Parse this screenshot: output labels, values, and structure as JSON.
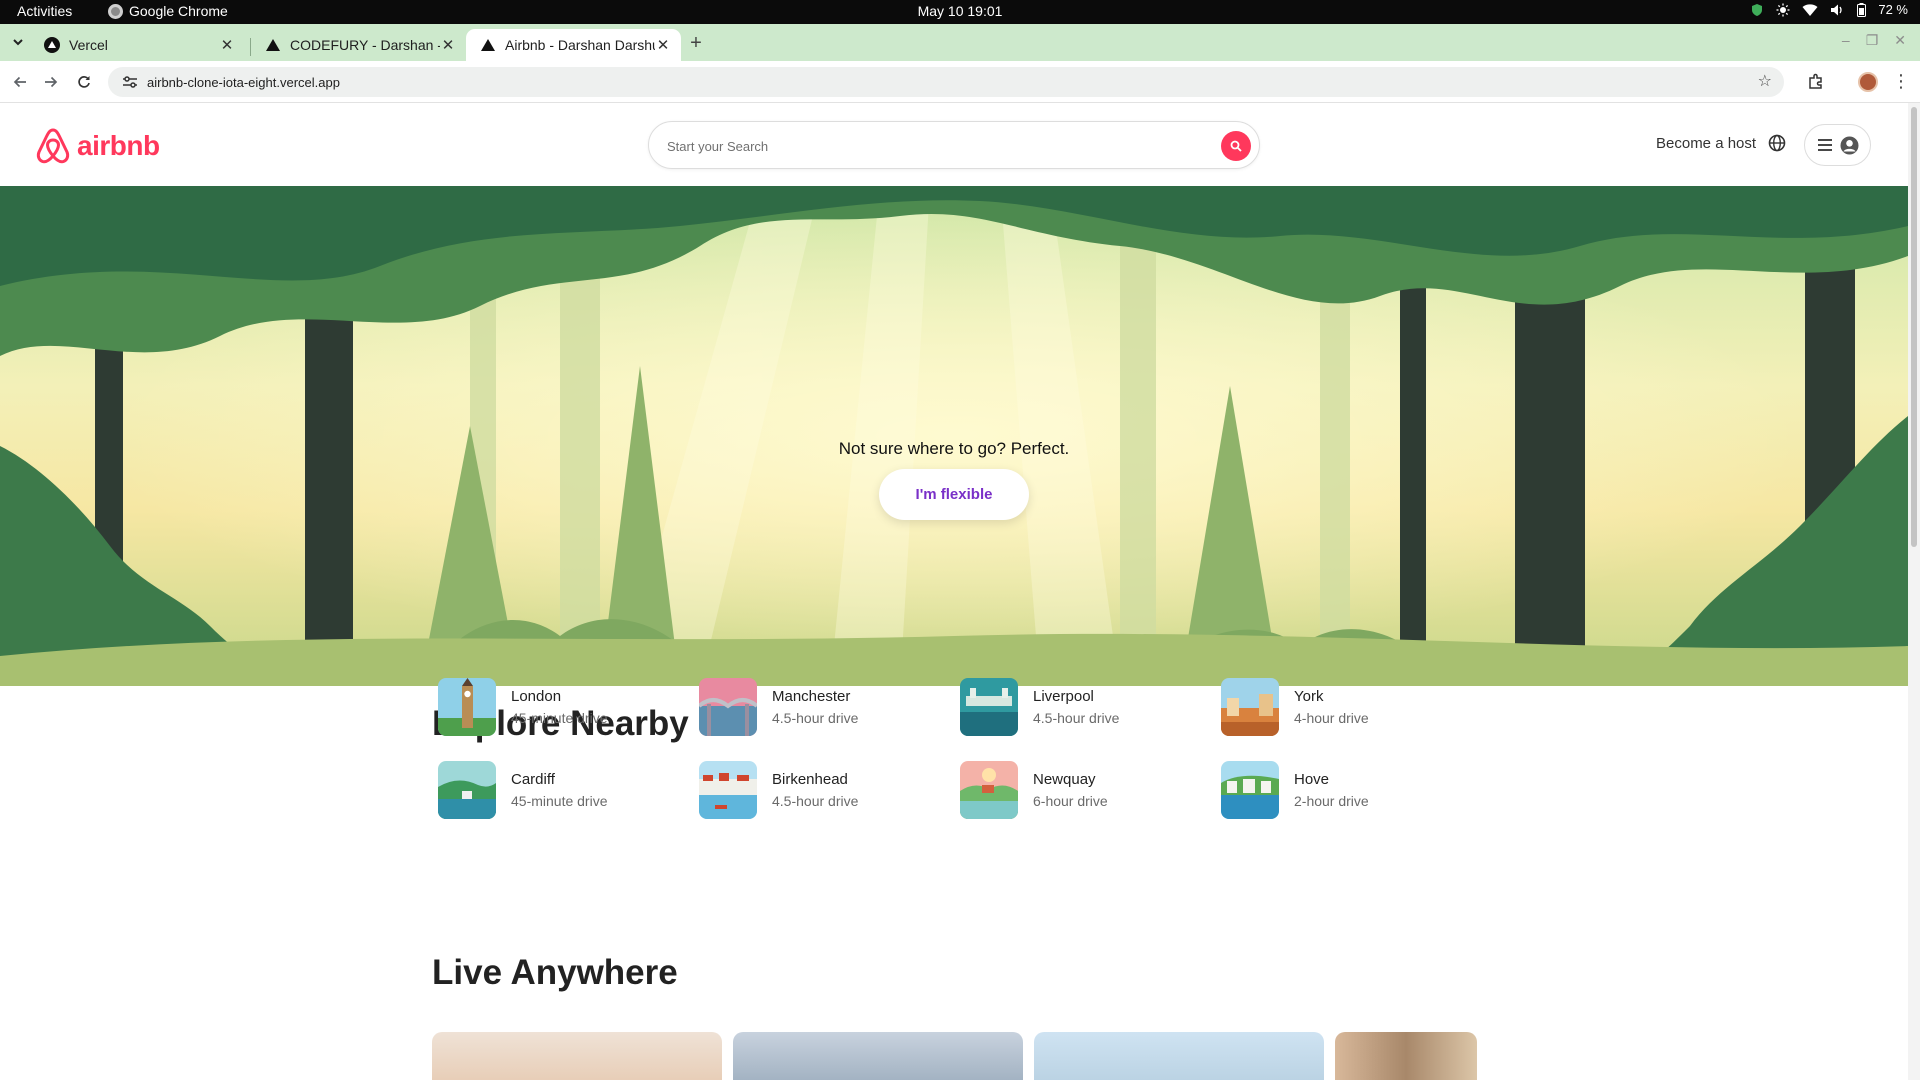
{
  "system": {
    "activities": "Activities",
    "app_name": "Google Chrome",
    "clock": "May 10  19:01",
    "battery": "72 %"
  },
  "browser": {
    "tabs": [
      {
        "title": "Vercel",
        "active": false
      },
      {
        "title": "CODEFURY - Darshan - S",
        "active": false
      },
      {
        "title": "Airbnb - Darshan Darshu",
        "active": true
      }
    ],
    "new_tab": "+",
    "url": "airbnb-clone-iota-eight.vercel.app"
  },
  "header": {
    "logo_text": "airbnb",
    "search_placeholder": "Start your Search",
    "host_link": "Become a host"
  },
  "hero": {
    "tagline": "Not sure where to go? Perfect.",
    "button": "I'm flexible"
  },
  "explore": {
    "title": "Explore Nearby",
    "places": [
      {
        "name": "London",
        "distance": "45-minute drive"
      },
      {
        "name": "Manchester",
        "distance": "4.5-hour drive"
      },
      {
        "name": "Liverpool",
        "distance": "4.5-hour drive"
      },
      {
        "name": "York",
        "distance": "4-hour drive"
      },
      {
        "name": "Cardiff",
        "distance": "45-minute drive"
      },
      {
        "name": "Birkenhead",
        "distance": "4.5-hour drive"
      },
      {
        "name": "Newquay",
        "distance": "6-hour drive"
      },
      {
        "name": "Hove",
        "distance": "2-hour drive"
      }
    ]
  },
  "live": {
    "title": "Live Anywhere"
  },
  "colors": {
    "brand": "#ff385c",
    "accent_purple": "#7a30c8",
    "tabstrip": "#cde9cc"
  }
}
